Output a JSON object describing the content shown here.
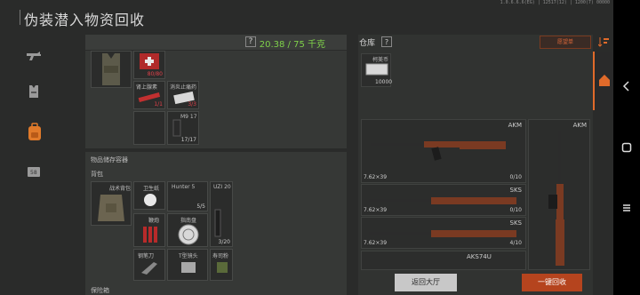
{
  "system": {
    "status": "1.0.6.6.6(EG) | 12517(12) | 1200(7) 00000"
  },
  "header": {
    "title": "伪装潜入物资回收"
  },
  "nav": {
    "items": [
      "gun-icon",
      "vest-icon",
      "backpack-icon",
      "case-icon"
    ]
  },
  "left": {
    "help": "?",
    "weight": "20.38 / 75 千克",
    "gear_slots": [
      {
        "title": "",
        "count": ""
      },
      {
        "title": "",
        "count": "80/80"
      },
      {
        "title": "肾上腺素",
        "count": "1/1"
      },
      {
        "title": "消炎止痛药",
        "count": "3/3"
      },
      {
        "title": "M9 17",
        "count": "17/17"
      }
    ],
    "storage_label": "物品储存容器",
    "backpack_label": "背包",
    "backpack_items": [
      {
        "title": "战术背包",
        "count": ""
      },
      {
        "title": "卫生纸",
        "count": ""
      },
      {
        "title": "Hunter 5",
        "count": "5/5"
      },
      {
        "title": "UZI 20",
        "count": "3/20"
      },
      {
        "title": "鞭炮",
        "count": ""
      },
      {
        "title": "指南盘",
        "count": ""
      },
      {
        "title": "钢笔刀",
        "count": ""
      },
      {
        "title": "T型镜头",
        "count": ""
      },
      {
        "title": "寿司粉",
        "count": ""
      }
    ],
    "safe_label": "保险箱"
  },
  "right": {
    "title": "仓库",
    "help": "?",
    "wishlist": "愿望单",
    "currency": {
      "label": "柯美币",
      "amount": "10000"
    },
    "guns": [
      {
        "name": "AKM",
        "caliber": "7.62×39",
        "count": "0/10",
        "count_red": true
      },
      {
        "name": "SKS",
        "caliber": "7.62×39",
        "count": "0/10",
        "count_red": true
      },
      {
        "name": "SKS",
        "caliber": "7.62×39",
        "count": "4/10",
        "count_red": false
      },
      {
        "name": "AKS74U",
        "caliber": "",
        "count": "",
        "count_red": false
      }
    ],
    "vertical_gun": {
      "name": "AKM"
    }
  },
  "buttons": {
    "back": "返回大厅",
    "recycle": "一键回收"
  },
  "colors": {
    "accent": "#e06a2a",
    "weight": "#7fd14a",
    "alert": "#e0404a"
  }
}
